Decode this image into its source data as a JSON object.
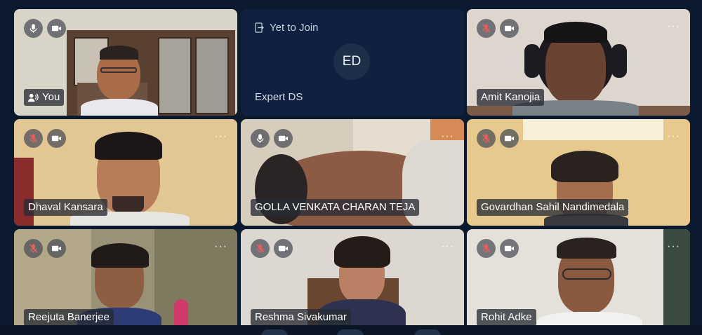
{
  "participants": [
    {
      "name": "You",
      "mic": "on",
      "cam": "on",
      "self": true
    },
    {
      "name": "Expert DS",
      "initials": "ED",
      "status": "Yet to Join"
    },
    {
      "name": "Amit Kanojia",
      "mic": "muted",
      "cam": "on"
    },
    {
      "name": "Dhaval Kansara",
      "mic": "muted",
      "cam": "on"
    },
    {
      "name": "GOLLA VENKATA CHARAN TEJA",
      "mic": "on",
      "cam": "on"
    },
    {
      "name": "Govardhan Sahil Nandimedala",
      "mic": "muted",
      "cam": "on"
    },
    {
      "name": "Reejuta Banerjee",
      "mic": "muted",
      "cam": "on"
    },
    {
      "name": "Reshma Sivakumar",
      "mic": "muted",
      "cam": "on"
    },
    {
      "name": "Rohit Adke",
      "mic": "muted",
      "cam": "on"
    }
  ],
  "colors": {
    "background": "#0b1a2e",
    "placeholder_tile": "#0f2040",
    "label_bg": "#282c34",
    "muted_icon": "#e06060"
  },
  "icons": [
    "mic-icon",
    "mic-muted-icon",
    "camera-icon",
    "more-options-icon",
    "speaker-person-icon",
    "sign-in-icon"
  ]
}
